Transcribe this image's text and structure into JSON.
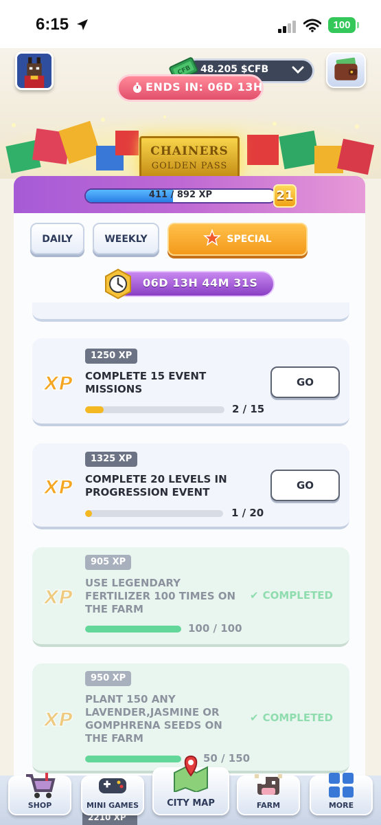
{
  "status_bar": {
    "time": "6:15",
    "battery": "100"
  },
  "header": {
    "currency_amount": "48.205 $CFB",
    "event_ends": "ENDS IN: 06D 13H"
  },
  "banner": {
    "title_line1": "CHAINERS",
    "title_line2": "GOLDEN PASS"
  },
  "xp_bar": {
    "text": "411 / 892 XP",
    "current": 411,
    "max": 892,
    "level": "21"
  },
  "tabs": [
    {
      "label": "DAILY",
      "active": false
    },
    {
      "label": "WEEKLY",
      "active": false
    },
    {
      "label": "SPECIAL",
      "active": true
    }
  ],
  "timer": "06D 13H 44M 31S",
  "missions": [
    {
      "xp": "1250 XP",
      "title": "COMPLETE 15 EVENT MISSIONS",
      "action": "GO",
      "progress_text": "2 / 15",
      "current": 2,
      "total": 15,
      "completed": false
    },
    {
      "xp": "1325 XP",
      "title": "COMPLETE 20 LEVELS IN PROGRESSION EVENT",
      "action": "GO",
      "progress_text": "1 / 20",
      "current": 1,
      "total": 20,
      "completed": false
    },
    {
      "xp": "905 XP",
      "title": "USE LEGENDARY FERTILIZER 100 TIMES ON THE FARM",
      "status": "COMPLETED",
      "progress_text": "100 / 100",
      "current": 100,
      "total": 100,
      "completed": true
    },
    {
      "xp": "950 XP",
      "title": "PLANT 150 ANY LAVENDER,JASMINE OR GOMPHRENA SEEDS ON THE FARM",
      "status": "COMPLETED",
      "progress_text": "50 / 150",
      "current": 150,
      "total": 150,
      "completed": true
    }
  ],
  "next_mission_xp": "2210 XP",
  "bottom_nav": [
    {
      "label": "SHOP",
      "icon": "cart-icon"
    },
    {
      "label": "MINI GAMES",
      "icon": "gamepad-icon"
    },
    {
      "label": "CITY MAP",
      "icon": "map-icon"
    },
    {
      "label": "FARM",
      "icon": "cow-icon"
    },
    {
      "label": "MORE",
      "icon": "grid-icon"
    }
  ],
  "colors": {
    "accent_orange": "#f39a1b",
    "accent_purple": "#a65bd6",
    "xp_blue": "#2b7de4",
    "progress_yellow": "#f4b822",
    "progress_green": "#63d69a",
    "completed_green": "#8fdcaf"
  }
}
